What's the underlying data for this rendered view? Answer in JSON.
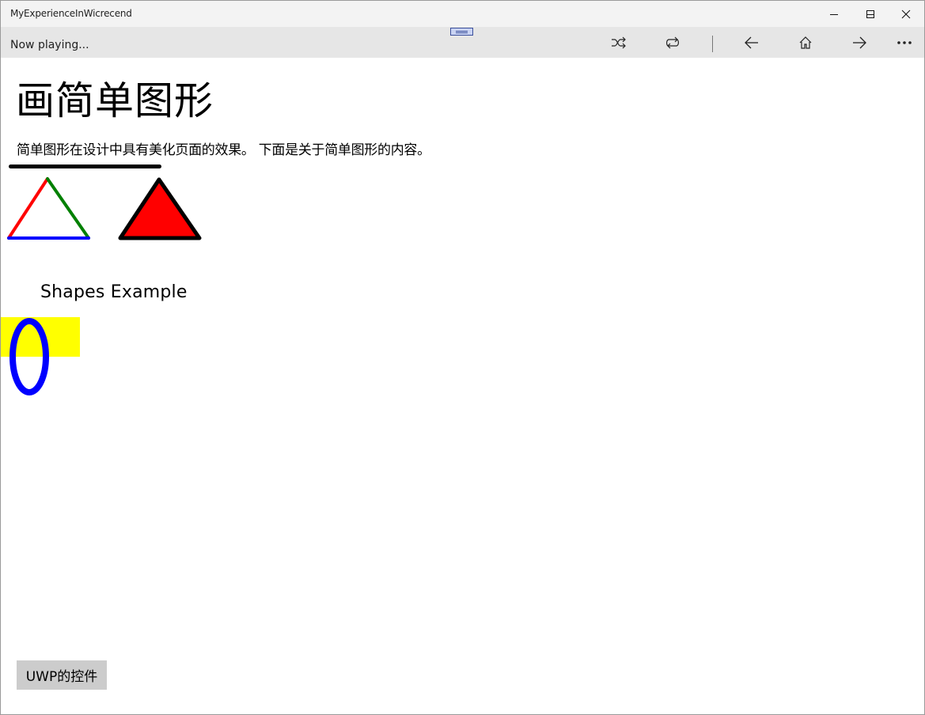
{
  "window": {
    "title": "MyExperienceInWicrecend",
    "minimize_icon": "minimize-icon",
    "maximize_icon": "maximize-icon",
    "close_icon": "close-icon"
  },
  "appbar": {
    "status": "Now playing...",
    "icons": [
      "shuffle-icon",
      "repeat-icon",
      "back-arrow-icon",
      "home-icon",
      "forward-arrow-icon",
      "more-icon"
    ]
  },
  "page": {
    "heading": "画简单图形",
    "description": "简单图形在设计中具有美化页面的效果。 下面是关于简单图形的内容。",
    "shapes_label": "Shapes Example",
    "button_label": "UWP的控件"
  },
  "shapes": {
    "triangle_outline_colors": [
      "#ff0000",
      "#008000",
      "#0000ff"
    ],
    "filled_triangle": {
      "fill": "#ff0000",
      "stroke": "#000000"
    },
    "rectangle_fill": "#ffff00",
    "ellipse_stroke": "#0000ff"
  }
}
